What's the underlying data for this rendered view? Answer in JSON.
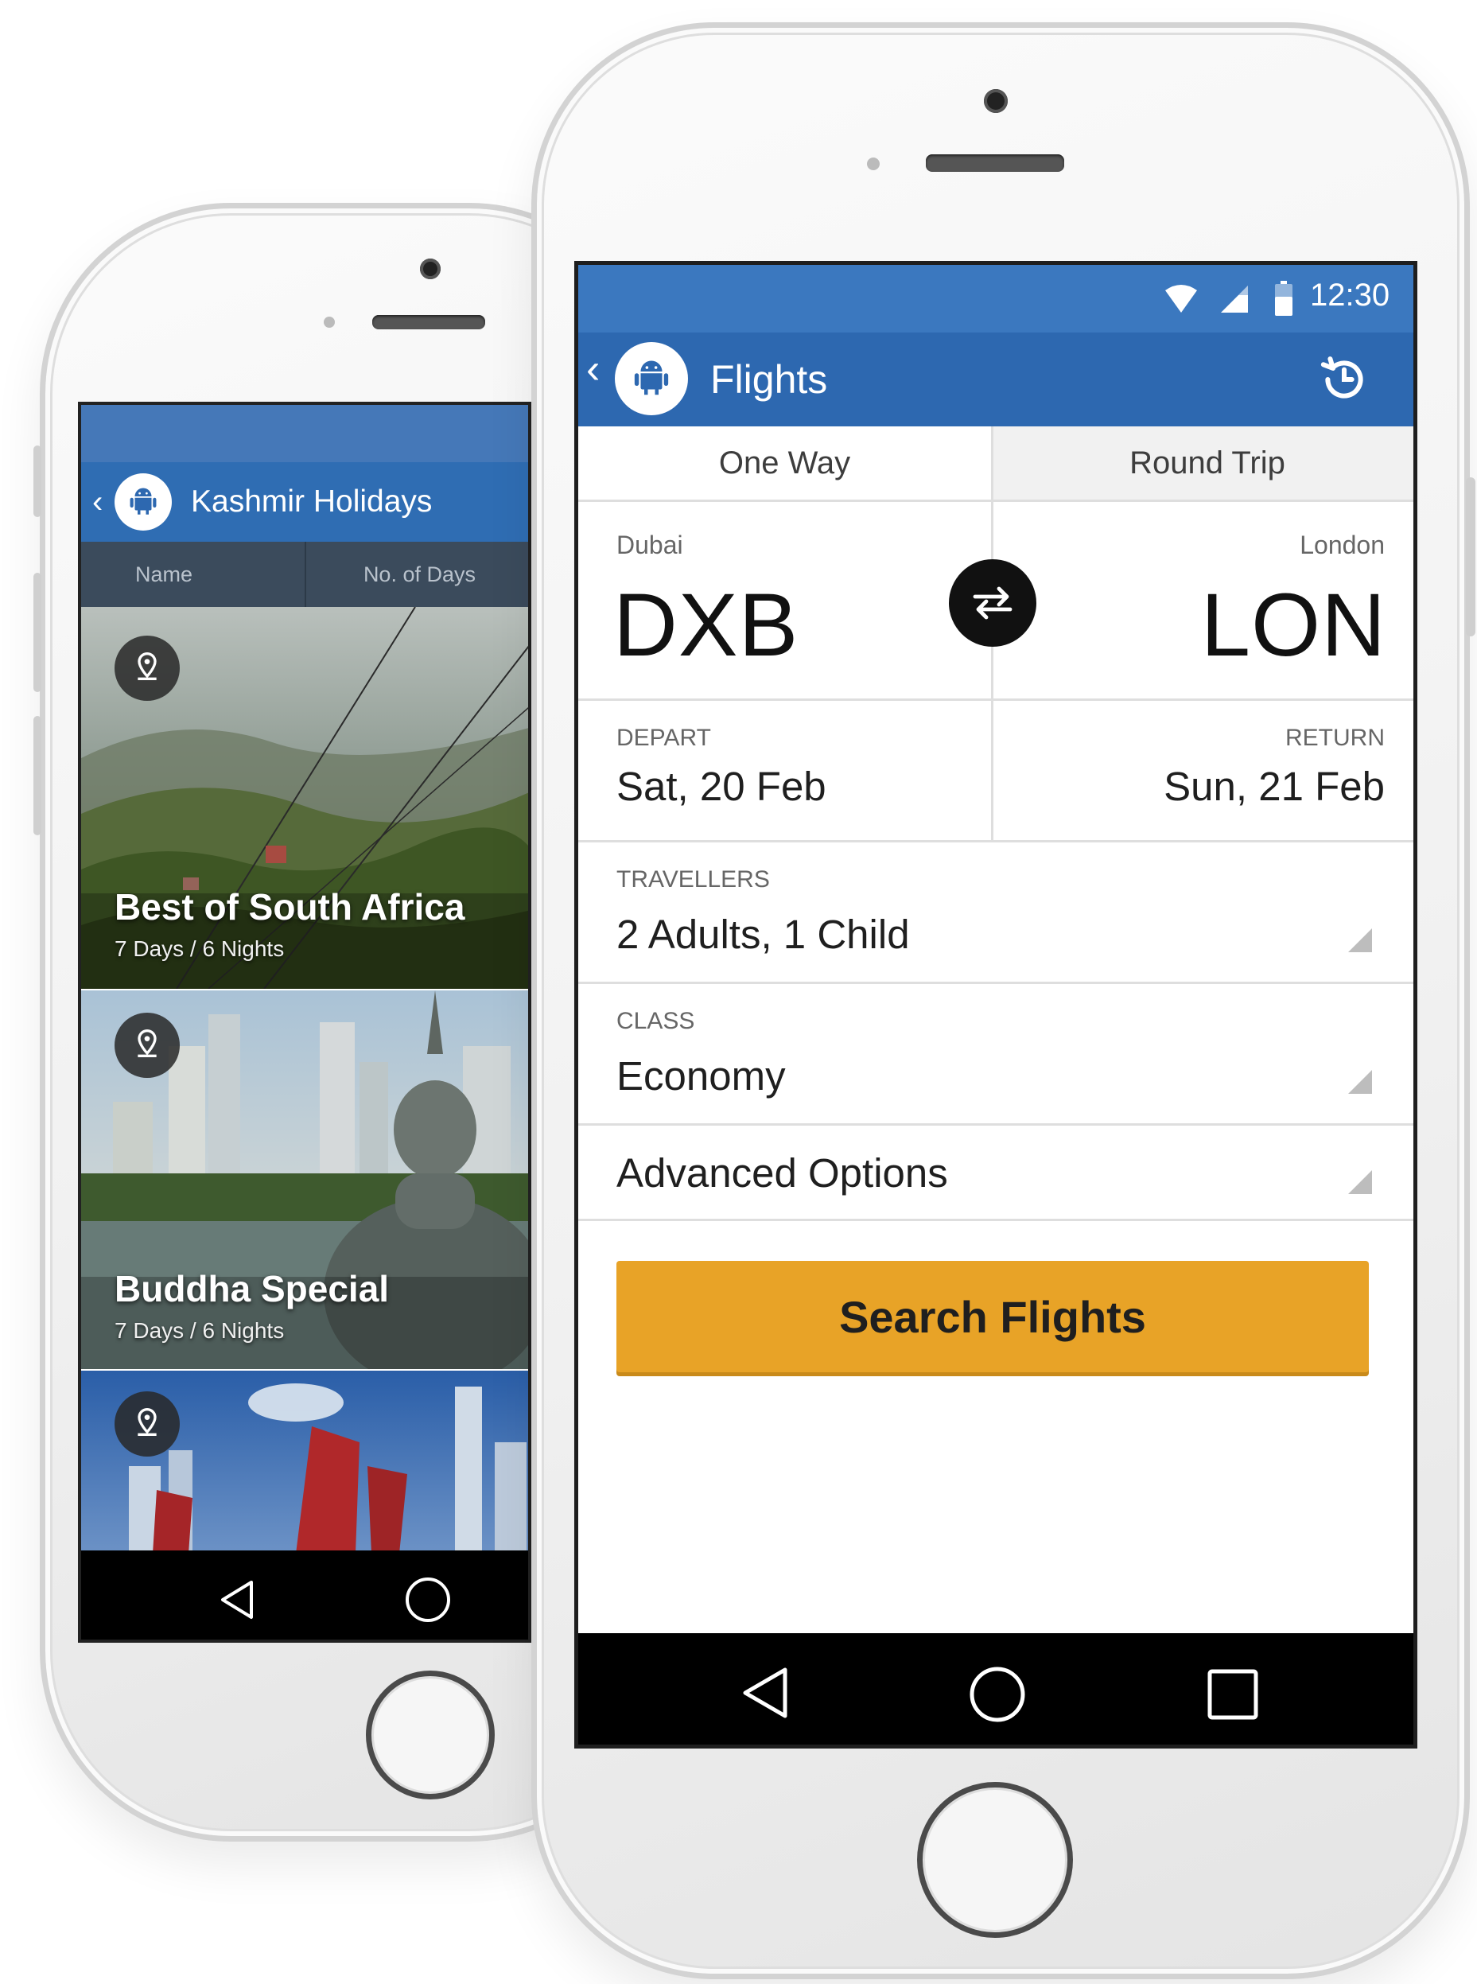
{
  "back_phone": {
    "toolbar": {
      "title": "Kashmir Holidays"
    },
    "tabs": [
      "Name",
      "No. of Days"
    ],
    "packages": [
      {
        "title": "Best of South Africa",
        "subtitle": "7 Days / 6 Nights"
      },
      {
        "title": "Buddha Special",
        "subtitle": "7 Days / 6 Nights"
      },
      {
        "title": "",
        "subtitle": ""
      }
    ]
  },
  "front_phone": {
    "status": {
      "time": "12:30"
    },
    "toolbar": {
      "title": "Flights"
    },
    "trip_tabs": {
      "one_way": "One Way",
      "round_trip": "Round Trip"
    },
    "route": {
      "from_city": "Dubai",
      "from_code": "DXB",
      "to_city": "London",
      "to_code": "LON"
    },
    "dates": {
      "depart_label": "DEPART",
      "depart_value": "Sat, 20 Feb",
      "return_label": "RETURN",
      "return_value": "Sun, 21 Feb"
    },
    "travellers": {
      "label": "TRAVELLERS",
      "value": "2 Adults, 1 Child"
    },
    "class": {
      "label": "CLASS",
      "value": "Economy"
    },
    "advanced": {
      "label": "Advanced Options"
    },
    "search_button": {
      "label": "Search Flights"
    }
  },
  "colors": {
    "primary": "#2d68b0",
    "status_bar": "#3b78bf",
    "accent": "#e8a327",
    "tab_bar": "#3b4b5c"
  }
}
